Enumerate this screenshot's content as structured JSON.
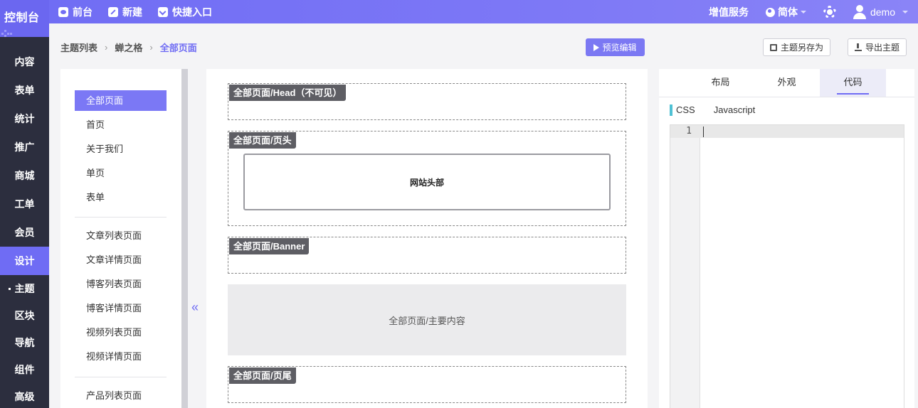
{
  "app": {
    "logo_text": "控制台"
  },
  "topbar": {
    "left_items": [
      {
        "label": "前台",
        "icon": "eye-icon"
      },
      {
        "label": "新建",
        "icon": "edit-icon"
      },
      {
        "label": "快捷入口",
        "icon": "chevron-down-icon"
      }
    ],
    "value_added": "增值服务",
    "language": "简体",
    "settings_icon": "gear-icon",
    "user": "demo"
  },
  "leftnav": {
    "items": [
      "内容",
      "表单",
      "统计",
      "推广",
      "商城",
      "工单",
      "会员",
      "设计"
    ],
    "active_item": "设计",
    "subitems": [
      "主题",
      "区块",
      "导航",
      "组件",
      "高级"
    ],
    "current_subitem": "主题"
  },
  "breadcrumb": {
    "items": [
      "主题列表",
      "蝉之格",
      "全部页面"
    ],
    "separator": "›"
  },
  "actions": {
    "preview_edit": "预览编辑",
    "save_theme_as": "主题另存为",
    "export_theme": "导出主题"
  },
  "page_list": {
    "group1": [
      "全部页面",
      "首页",
      "关于我们",
      "单页",
      "表单"
    ],
    "group2": [
      "文章列表页面",
      "文章详情页面",
      "博客列表页面",
      "博客详情页面",
      "视频列表页面",
      "视频详情页面"
    ],
    "group3": [
      "产品列表页面"
    ],
    "active": "全部页面",
    "collapse_symbol": "«"
  },
  "canvas": {
    "blocks": {
      "head": "全部页面/Head（不可见）",
      "header": "全部页面/页头",
      "header_content": "网站头部",
      "banner": "全部页面/Banner",
      "main": "全部页面/主要内容",
      "footer": "全部页面/页尾"
    }
  },
  "right_panel": {
    "tabs": [
      "布局",
      "外观",
      "代码"
    ],
    "active_tab": "代码",
    "code_tabs": [
      "CSS",
      "Javascript"
    ],
    "active_code_tab": "CSS",
    "line_numbers": [
      "1"
    ]
  },
  "colors": {
    "accent": "#6f6cf4",
    "nav_bg": "#2c2e3e",
    "css_marker": "#4fc1d4"
  }
}
